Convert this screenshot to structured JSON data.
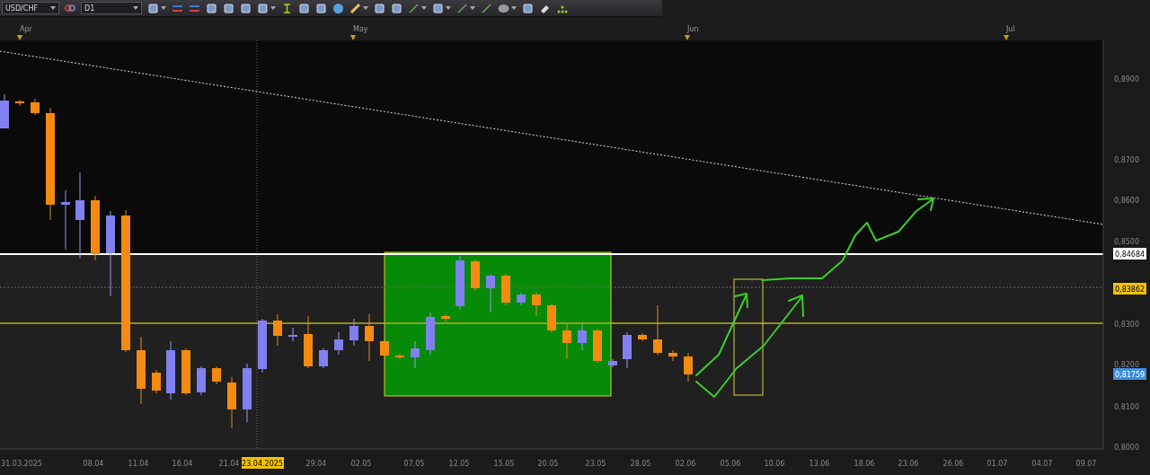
{
  "toolbar": {
    "symbol": "USD/CHF",
    "timeframe": "D1"
  },
  "months": [
    "Apr",
    "May",
    "Jun",
    "Jul"
  ],
  "price_ticks": [
    "0,8900",
    "0,8700",
    "0,8600",
    "0,8500",
    "0,8300",
    "0,8200",
    "0,8100",
    "0,8000"
  ],
  "price_labels": [
    {
      "text": "0,84684",
      "color": "#ffffff"
    },
    {
      "text": "0,83862",
      "color": "#f2c200"
    },
    {
      "text": "0,81759",
      "color": "#3d8fe0"
    }
  ],
  "date_labels": [
    {
      "text": "31.03.2025",
      "selected": false
    },
    {
      "text": "08.04",
      "selected": false
    },
    {
      "text": "11.04",
      "selected": false
    },
    {
      "text": "16.04",
      "selected": false
    },
    {
      "text": "21.04",
      "selected": false
    },
    {
      "text": "23.04.2025",
      "selected": true
    },
    {
      "text": "29.04",
      "selected": false
    },
    {
      "text": "02.05",
      "selected": false
    },
    {
      "text": "07.05",
      "selected": false
    },
    {
      "text": "12.05",
      "selected": false
    },
    {
      "text": "15.05",
      "selected": false
    },
    {
      "text": "20.05",
      "selected": false
    },
    {
      "text": "23.05",
      "selected": false
    },
    {
      "text": "28.05",
      "selected": false
    },
    {
      "text": "02.06",
      "selected": false
    },
    {
      "text": "05.06",
      "selected": false
    },
    {
      "text": "10.06",
      "selected": false
    },
    {
      "text": "13.06",
      "selected": false
    },
    {
      "text": "18.06",
      "selected": false
    },
    {
      "text": "23.06",
      "selected": false
    },
    {
      "text": "26.06",
      "selected": false
    },
    {
      "text": "01.07",
      "selected": false
    },
    {
      "text": "04.07",
      "selected": false
    },
    {
      "text": "09.07",
      "selected": false
    }
  ]
}
